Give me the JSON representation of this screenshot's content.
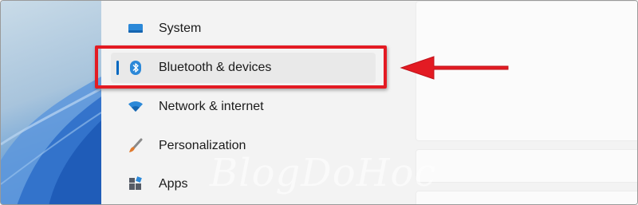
{
  "settings_sidebar": {
    "items": [
      {
        "label": "System",
        "icon": "system-monitor-icon",
        "selected": false
      },
      {
        "label": "Bluetooth & devices",
        "icon": "bluetooth-icon",
        "selected": true
      },
      {
        "label": "Network & internet",
        "icon": "wifi-icon",
        "selected": false
      },
      {
        "label": "Personalization",
        "icon": "paintbrush-icon",
        "selected": false
      },
      {
        "label": "Apps",
        "icon": "apps-icon",
        "selected": false
      }
    ]
  },
  "annotation": {
    "highlight_color": "#e31b23",
    "arrow_color": "#e31b23",
    "watermark": "BlogDoHoc"
  },
  "colors": {
    "accent": "#0067c0",
    "sidebar_bg": "#f3f3f3",
    "selected_bg": "#e9e9e9"
  }
}
